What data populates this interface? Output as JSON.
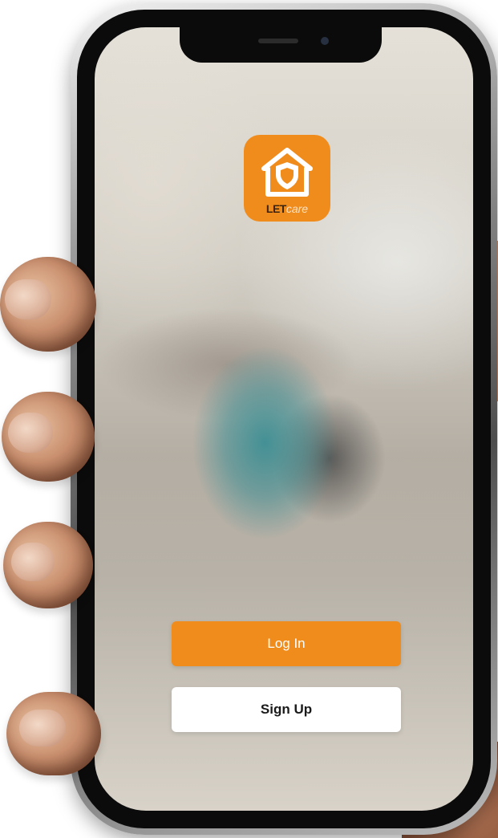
{
  "app": {
    "logo_word_strong": "LET",
    "logo_word_light": "care"
  },
  "actions": {
    "login_label": "Log In",
    "signup_label": "Sign Up"
  },
  "colors": {
    "brand_orange": "#f08c1c",
    "button_white": "#ffffff"
  },
  "icons": {
    "logo": "house-shield-icon"
  }
}
